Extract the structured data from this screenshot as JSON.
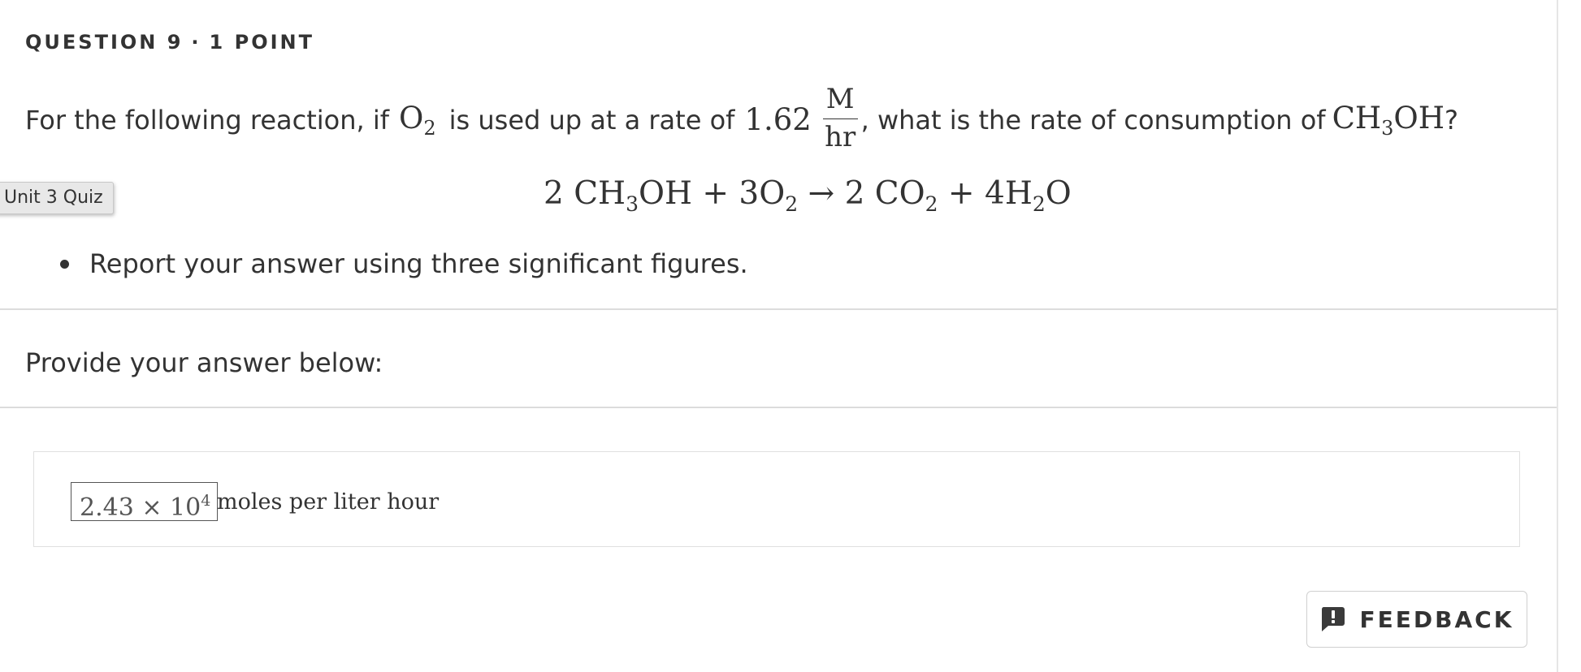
{
  "question": {
    "header": {
      "number": "QUESTION 9",
      "separator": "·",
      "points": "1 POINT"
    },
    "prompt": {
      "part1": "For the following reaction, if",
      "o2_base": "O",
      "o2_sub": "2",
      "part2": "is used up at a rate of",
      "rate_value": "1.62",
      "rate_unit_num": "M",
      "rate_unit_den": "hr",
      "part3": ", what is the rate of consumption of",
      "ch3oh_a": "CH",
      "ch3oh_sub": "3",
      "ch3oh_b": "OH",
      "part4": "?"
    },
    "equation": {
      "c1": "2 CH",
      "s1": "3",
      "c2": "OH + 3O",
      "s2": "2",
      "c3": " → 2 CO",
      "s3": "2",
      "c4": " + 4H",
      "s4": "2",
      "c5": "O"
    },
    "bullet": "Report your answer using three significant figures."
  },
  "tooltip": "Unit 3 Quiz",
  "answer_section": {
    "prompt": "Provide your answer below:",
    "value_mantissa": "2.43 × 10",
    "value_exponent": "4",
    "unit": "moles per liter hour"
  },
  "feedback_button": {
    "label": "FEEDBACK",
    "icon": "feedback-speech-bubble-icon"
  }
}
